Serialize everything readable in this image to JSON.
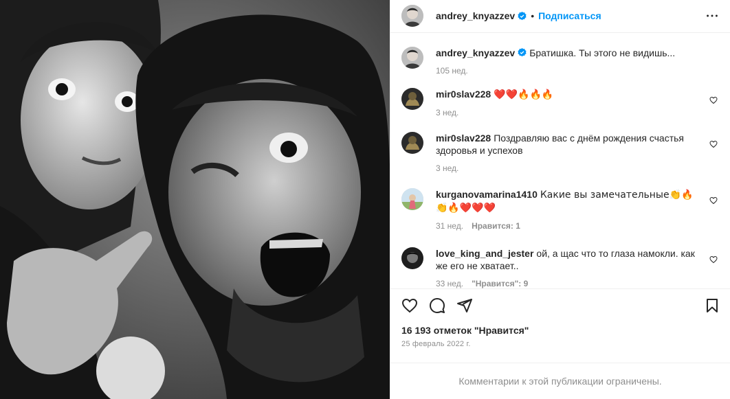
{
  "post": {
    "author": "andrey_knyazzev",
    "follow_label": "Подписаться",
    "separator": "•",
    "likes_text": "16 193 отметок \"Нравится\"",
    "date": "25 февраль 2022 г.",
    "comments_limited": "Комментарии к этой публикации ограничены."
  },
  "caption": {
    "user": "andrey_knyazzev",
    "text": "Братишка. Ты этого не видишь...",
    "time": "105 нед."
  },
  "comments": [
    {
      "user": "mir0slav228",
      "text": "❤️❤️🔥🔥🔥",
      "time": "3 нед.",
      "likes": ""
    },
    {
      "user": "mir0slav228",
      "text": "Поздравляю вас с днём рождения счастья здоровья и успехов",
      "time": "3 нед.",
      "likes": ""
    },
    {
      "user": "kurganovamarina1410",
      "text": "Какие вы замечательные👏🔥👏🔥❤️❤️❤️",
      "time": "31 нед.",
      "likes": "Нравится: 1"
    },
    {
      "user": "love_king_and_jester",
      "text": "ой, а щас что то глаза намокли. как же его не хватает..",
      "time": "33 нед.",
      "likes": "\"Нравится\": 9"
    }
  ],
  "icons": {
    "verified": "verified-badge-icon",
    "more": "more-options-icon",
    "like": "heart-icon",
    "comment": "comment-icon",
    "share": "share-icon",
    "save": "bookmark-icon"
  },
  "colors": {
    "accent": "#0095f6",
    "text": "#262626",
    "muted": "#8e8e8e",
    "border": "#efefef"
  }
}
